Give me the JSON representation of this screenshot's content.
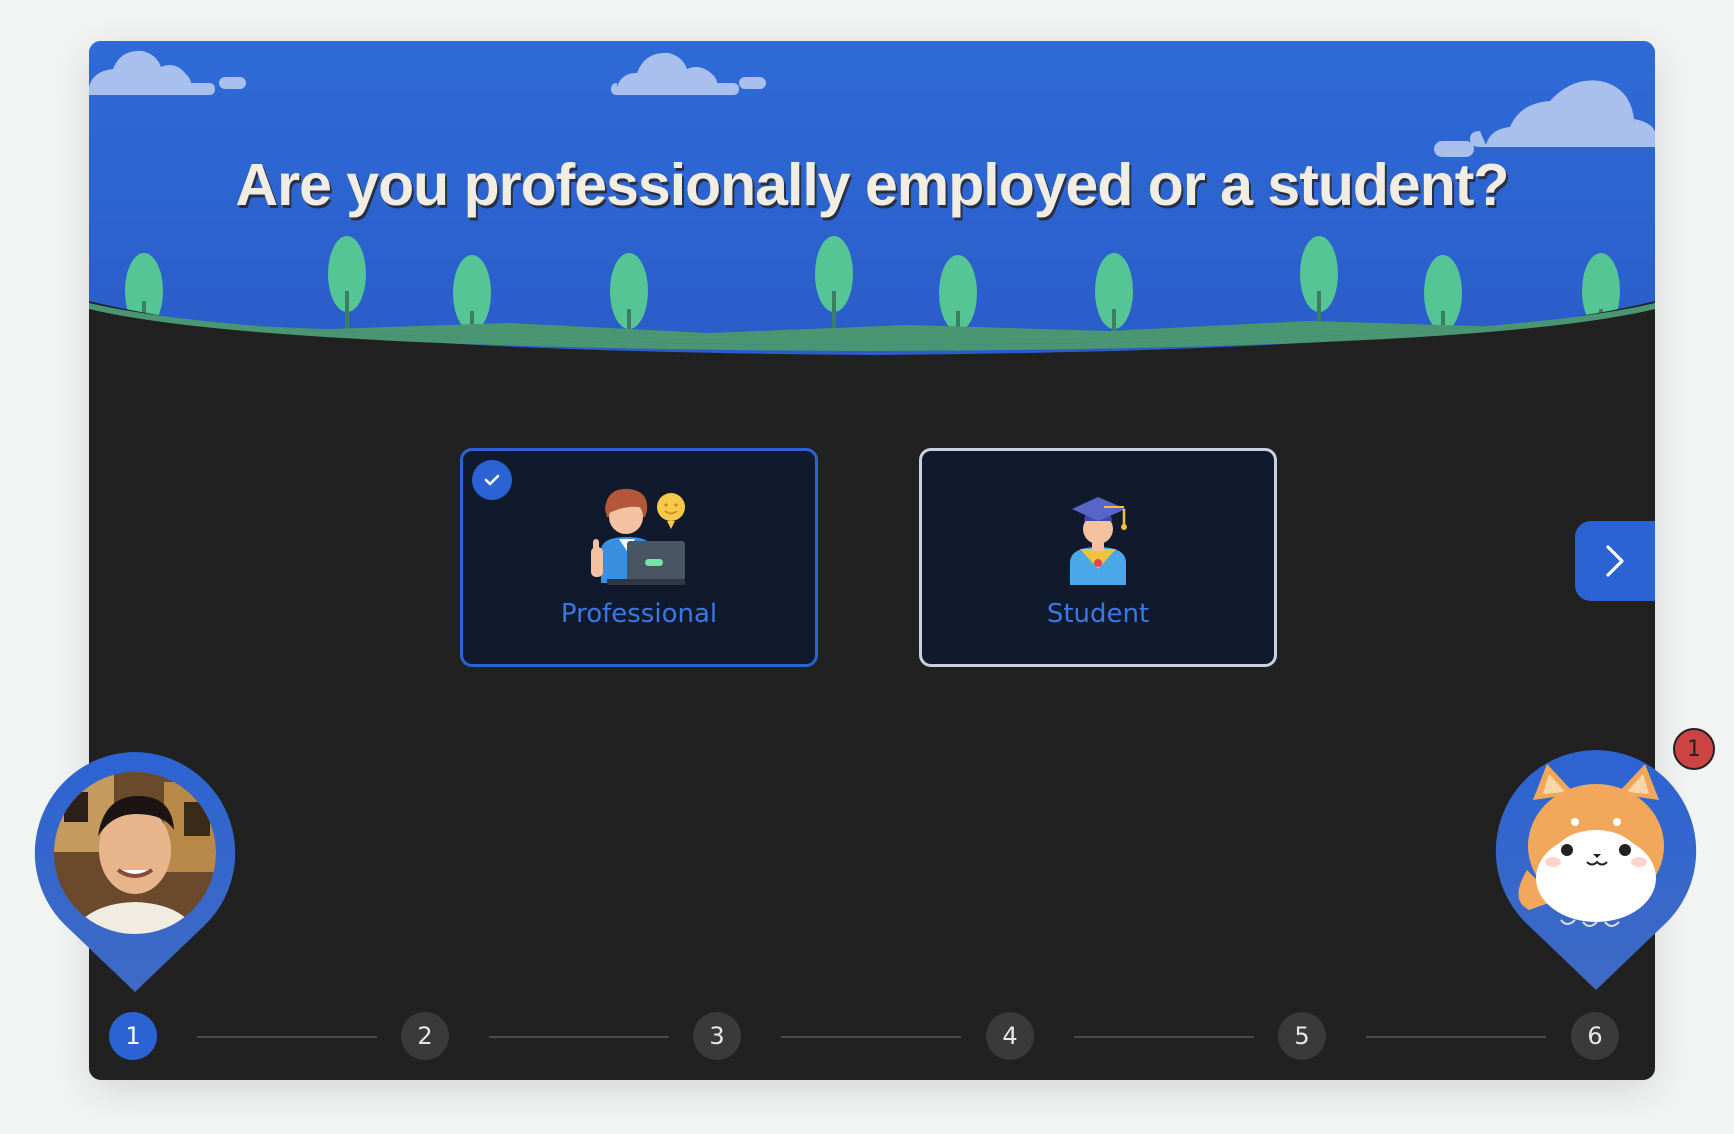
{
  "question": {
    "title": "Are you professionally employed or a student?"
  },
  "options": [
    {
      "label": "Professional",
      "selected": true,
      "icon": "professional-illustration"
    },
    {
      "label": "Student",
      "selected": false,
      "icon": "graduate-illustration"
    }
  ],
  "navigation": {
    "next_icon": "chevron-right-icon"
  },
  "notification": {
    "count": "1"
  },
  "stepper": {
    "steps": [
      "1",
      "2",
      "3",
      "4",
      "5",
      "6"
    ],
    "current": "1"
  },
  "colors": {
    "accent": "#2c63d4",
    "sky": "#2e6bd7",
    "grass": "#4a9572",
    "tree": "#55c596",
    "card_bg": "#212121",
    "option_bg": "#111a2d",
    "badge": "#cc4444"
  }
}
